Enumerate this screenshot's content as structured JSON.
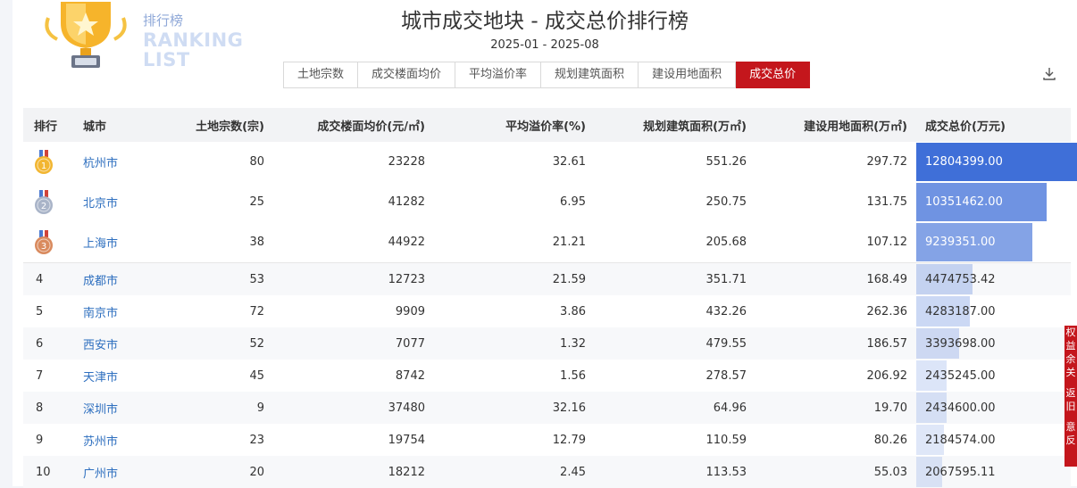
{
  "header": {
    "brand_cn": "排行榜",
    "brand_en_line1": "RANKING",
    "brand_en_line2": "LIST",
    "title": "城市成交地块 - 成交总价排行榜",
    "date_range": "2025-01 - 2025-08"
  },
  "tabs": [
    {
      "label": "土地宗数",
      "active": false
    },
    {
      "label": "成交楼面均价",
      "active": false
    },
    {
      "label": "平均溢价率",
      "active": false
    },
    {
      "label": "规划建筑面积",
      "active": false
    },
    {
      "label": "建设用地面积",
      "active": false
    },
    {
      "label": "成交总价",
      "active": true
    }
  ],
  "icons": {
    "download": "download-icon",
    "trophy": "trophy-icon"
  },
  "colors": {
    "accent_red": "#c4161c",
    "bar_color": "#3f6fd8",
    "link": "#2e6fbf",
    "gold": "#f2b632",
    "silver": "#a9b4c8",
    "bronze": "#d98a5e"
  },
  "table": {
    "columns": [
      "排行",
      "城市",
      "土地宗数(宗)",
      "成交楼面均价(元/㎡)",
      "平均溢价率(%)",
      "规划建筑面积(万㎡)",
      "建设用地面积(万㎡)",
      "成交总价(万元)"
    ],
    "rows": [
      {
        "rank": "1",
        "city": "杭州市",
        "count": "80",
        "price": "23228",
        "premium": "32.61",
        "planned": "551.26",
        "land": "297.72",
        "total": "12804399.00"
      },
      {
        "rank": "2",
        "city": "北京市",
        "count": "25",
        "price": "41282",
        "premium": "6.95",
        "planned": "250.75",
        "land": "131.75",
        "total": "10351462.00"
      },
      {
        "rank": "3",
        "city": "上海市",
        "count": "38",
        "price": "44922",
        "premium": "21.21",
        "planned": "205.68",
        "land": "107.12",
        "total": "9239351.00"
      },
      {
        "rank": "4",
        "city": "成都市",
        "count": "53",
        "price": "12723",
        "premium": "21.59",
        "planned": "351.71",
        "land": "168.49",
        "total": "4474753.42"
      },
      {
        "rank": "5",
        "city": "南京市",
        "count": "72",
        "price": "9909",
        "premium": "3.86",
        "planned": "432.26",
        "land": "262.36",
        "total": "4283187.00"
      },
      {
        "rank": "6",
        "city": "西安市",
        "count": "52",
        "price": "7077",
        "premium": "1.32",
        "planned": "479.55",
        "land": "186.57",
        "total": "3393698.00"
      },
      {
        "rank": "7",
        "city": "天津市",
        "count": "45",
        "price": "8742",
        "premium": "1.56",
        "planned": "278.57",
        "land": "206.92",
        "total": "2435245.00"
      },
      {
        "rank": "8",
        "city": "深圳市",
        "count": "9",
        "price": "37480",
        "premium": "32.16",
        "planned": "64.96",
        "land": "19.70",
        "total": "2434600.00"
      },
      {
        "rank": "9",
        "city": "苏州市",
        "count": "23",
        "price": "19754",
        "premium": "12.79",
        "planned": "110.59",
        "land": "80.26",
        "total": "2184574.00"
      },
      {
        "rank": "10",
        "city": "广州市",
        "count": "20",
        "price": "18212",
        "premium": "2.45",
        "planned": "113.53",
        "land": "55.03",
        "total": "2067595.11"
      }
    ]
  },
  "side_tab": [
    "权",
    "益",
    "余",
    "关",
    "",
    "返",
    "旧",
    "",
    "意",
    "反"
  ]
}
